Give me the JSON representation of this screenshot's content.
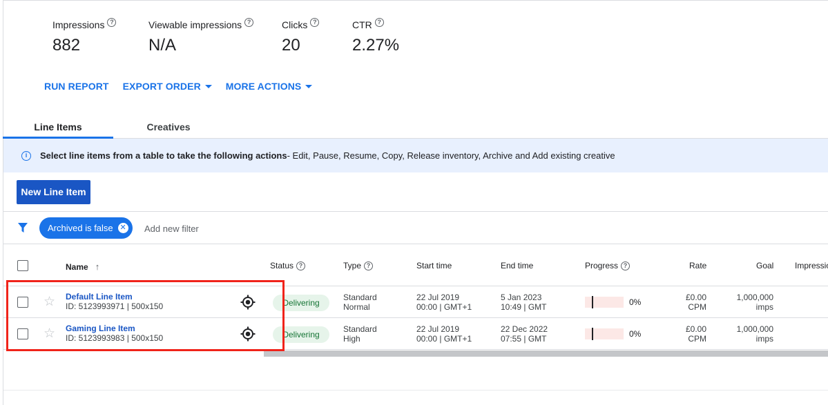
{
  "stats": [
    {
      "label": "Impressions",
      "value": "882"
    },
    {
      "label": "Viewable impressions",
      "value": "N/A"
    },
    {
      "label": "Clicks",
      "value": "20"
    },
    {
      "label": "CTR",
      "value": "2.27%"
    }
  ],
  "help_glyph": "?",
  "actions": {
    "run_report": "RUN REPORT",
    "export_order": "EXPORT ORDER",
    "more_actions": "MORE ACTIONS"
  },
  "tabs": [
    {
      "label": "Line Items",
      "active": true
    },
    {
      "label": "Creatives",
      "active": false
    }
  ],
  "banner": {
    "icon": "info-icon",
    "bold_text": "Select line items from a table to take the following actions",
    "text": " - Edit, Pause, Resume, Copy, Release inventory, Archive and Add existing creative"
  },
  "new_line_item_label": "New Line Item",
  "filter": {
    "chip_label": "Archived is false",
    "add_filter_label": "Add new filter"
  },
  "table": {
    "headers": {
      "name": "Name",
      "status": "Status",
      "type": "Type",
      "start_time": "Start time",
      "end_time": "End time",
      "progress": "Progress",
      "rate": "Rate",
      "goal": "Goal",
      "impressions": "Impressio"
    },
    "rows": [
      {
        "name": "Default Line Item",
        "id_line": "ID: 5123993971 | 500x150",
        "status": "Delivering",
        "type": "Standard",
        "priority": "Normal",
        "start_date": "22 Jul 2019",
        "start_time": "00:00 | GMT+1",
        "end_date": "5 Jan 2023",
        "end_time": "10:49 | GMT",
        "progress_pct": "0%",
        "progress_value": 0,
        "rate": "£0.00",
        "rate_unit": "CPM",
        "goal": "1,000,000",
        "goal_unit": "imps"
      },
      {
        "name": "Gaming Line Item",
        "id_line": "ID: 5123993983 | 500x150",
        "status": "Delivering",
        "type": "Standard",
        "priority": "High",
        "start_date": "22 Jul 2019",
        "start_time": "00:00 | GMT+1",
        "end_date": "22 Dec 2022",
        "end_time": "07:55 | GMT",
        "progress_pct": "0%",
        "progress_value": 0,
        "rate": "£0.00",
        "rate_unit": "CPM",
        "goal": "1,000,000",
        "goal_unit": "imps"
      }
    ]
  },
  "colors": {
    "accent": "#1a73e8",
    "primary_button": "#1a56c4",
    "banner_bg": "#e8f0fe",
    "status_bg": "#e6f4ea",
    "status_text": "#137333",
    "highlight": "#f0231a"
  }
}
